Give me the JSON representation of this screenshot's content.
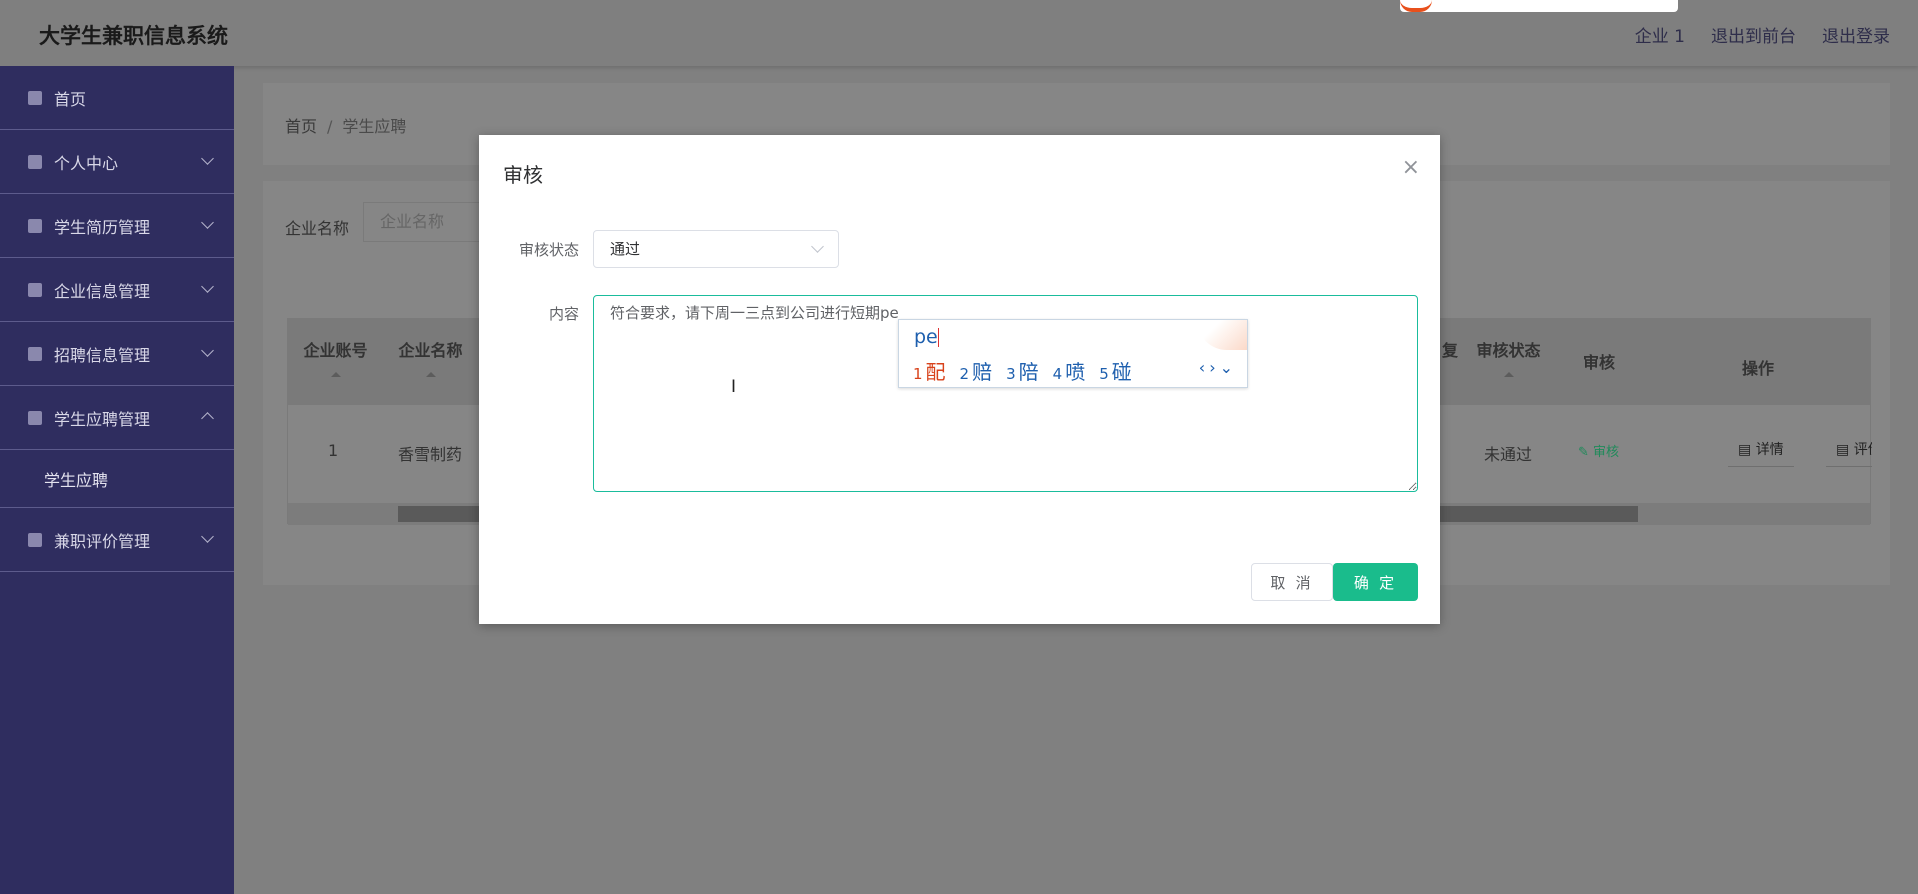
{
  "header": {
    "title": "大学生兼职信息系统",
    "links": [
      "企业 1",
      "退出到前台",
      "退出登录"
    ]
  },
  "sidebar": {
    "items": [
      {
        "label": "首页",
        "icon": "home-icon"
      },
      {
        "label": "个人中心",
        "icon": "user-icon"
      },
      {
        "label": "学生简历管理",
        "icon": "resume-icon"
      },
      {
        "label": "企业信息管理",
        "icon": "user-icon"
      },
      {
        "label": "招聘信息管理",
        "icon": "recruit-icon"
      },
      {
        "label": "学生应聘管理",
        "icon": "clipboard-icon",
        "expanded": true,
        "children": [
          "学生应聘"
        ]
      },
      {
        "label": "兼职评价管理",
        "icon": "grid-icon"
      }
    ]
  },
  "breadcrumb": [
    "首页",
    "学生应聘"
  ],
  "search": {
    "label": "企业名称",
    "placeholder": "企业名称"
  },
  "table": {
    "columns": [
      "企业账号",
      "企业名称",
      "复",
      "审核状态",
      "审核",
      "操作"
    ],
    "rows": [
      {
        "account": "1",
        "name": "香雪制药",
        "status": "未通过",
        "audit": "审核",
        "actions": [
          "详情",
          "评价"
        ]
      }
    ]
  },
  "modal": {
    "title": "审核",
    "close": "×",
    "status_label": "审核状态",
    "status_value": "通过",
    "content_label": "内容",
    "content_value": "符合要求，请下周一三点到公司进行短期pe",
    "cancel": "取 消",
    "confirm": "确 定"
  },
  "ime": {
    "composition": "pe",
    "candidates": [
      "配",
      "赔",
      "陪",
      "喷",
      "碰"
    ],
    "nav": "‹›⌄"
  },
  "colors": {
    "accent": "#1abc8c",
    "sidebar": "#2f2d5f",
    "ime_highlight": "#d8421b"
  }
}
